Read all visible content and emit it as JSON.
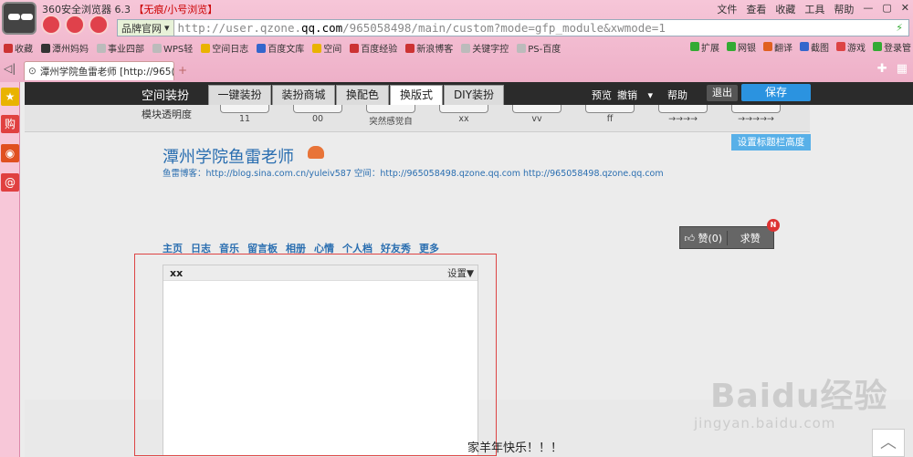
{
  "browser": {
    "title": "360安全浏览器 6.3",
    "mode": "【无痕/小号浏览】",
    "menu": [
      "文件",
      "查看",
      "收藏",
      "工具",
      "帮助"
    ],
    "address_select": "品牌官网",
    "url_prefix": "http://user.qzone.",
    "url_domain": "qq.com",
    "url_suffix": "/965058498/main/custom?mode=gfp_module&xwmode=1",
    "favorites": [
      "收藏",
      "潭州妈妈",
      "事业四部",
      "WPS轻",
      "空间日志",
      "百度文库",
      "空间",
      "百度经验",
      "新浪博客",
      "关键字控",
      "PS-百度"
    ],
    "favorites_right": [
      "扩展",
      "网银",
      "翻译",
      "截图",
      "游戏",
      "登录管"
    ],
    "tab_label": "潭州学院鱼雷老师 [http://965(",
    "new_tab": "+",
    "fav_colors": [
      "#c33",
      "#333",
      "#bbb",
      "#bbb",
      "#e9b300",
      "#36c",
      "#e9b300",
      "#c33",
      "#c33",
      "#bbb",
      "#bbb"
    ],
    "fav_right_colors": [
      "#3a3",
      "#3a3",
      "#e06020",
      "#36c",
      "#d44",
      "#3a3"
    ]
  },
  "sidebar": {
    "icons": [
      "star-icon",
      "shopping-icon",
      "weibo-icon",
      "email-icon"
    ],
    "colors": [
      "#e9b300",
      "#e04040",
      "#e05020",
      "#e04040"
    ],
    "glyphs": [
      "★",
      "购",
      "◉",
      "@"
    ]
  },
  "qzone_bar": {
    "title": "空间装扮",
    "tabs": [
      "一键装扮",
      "装扮商城",
      "换配色",
      "换版式",
      "DIY装扮"
    ],
    "preview": "预览",
    "undo": "撤销",
    "help": "帮助",
    "exit": "退出",
    "save": "保存"
  },
  "sub_bar": {
    "transparency": "模块透明度",
    "slots": [
      "11",
      "00",
      "突然感觉自",
      "xx",
      "vv",
      "ff",
      "→→→→",
      "→→→→→"
    ],
    "title_height_button": "设置标题栏高度"
  },
  "page": {
    "title": "潭州学院鱼雷老师",
    "subline": "鱼雷博客：http://blog.sina.com.cn/yuleiv587 空间：http://965058498.qzone.qq.com    http://965058498.qzone.qq.com",
    "nav": [
      "主页",
      "日志",
      "音乐",
      "留言板",
      "相册",
      "心情",
      "个人档",
      "好友秀",
      "更多"
    ],
    "like_label": "赞(0)",
    "gift_label": "求赞",
    "badge": "N",
    "module_title": "xx",
    "module_settings": "设置▼",
    "bottom_text": "家羊年快乐！！！"
  },
  "watermark": {
    "brand": "Baidu经验",
    "url": "jingyan.baidu.com"
  },
  "back_to_top": "︿"
}
